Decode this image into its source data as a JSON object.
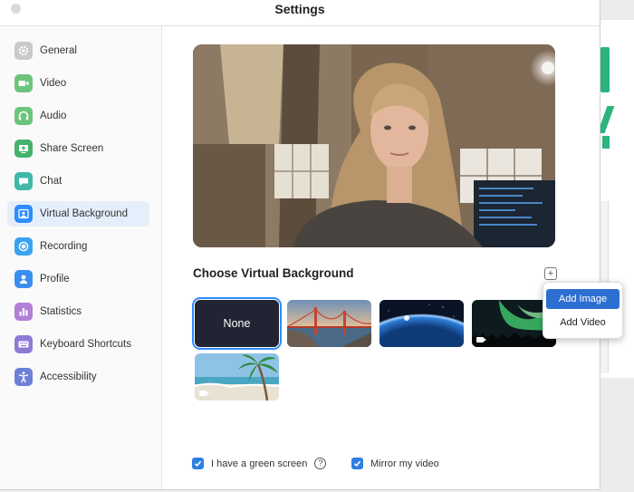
{
  "window": {
    "title": "Settings"
  },
  "colors": {
    "accent": "#2d8cff",
    "selection": "#e4effb",
    "menu_highlight": "#2d6fd1"
  },
  "sidebar": {
    "active": "Virtual Background",
    "items": [
      {
        "label": "General",
        "icon": "gear-icon",
        "color": "#c9c9c9"
      },
      {
        "label": "Video",
        "icon": "video-camera-icon",
        "color": "#6cc47c"
      },
      {
        "label": "Audio",
        "icon": "headphones-icon",
        "color": "#6cc47c"
      },
      {
        "label": "Share Screen",
        "icon": "share-screen-icon",
        "color": "#45b36b"
      },
      {
        "label": "Chat",
        "icon": "chat-bubble-icon",
        "color": "#40b8a8"
      },
      {
        "label": "Virtual Background",
        "icon": "virtual-background-icon",
        "color": "#2d8cff"
      },
      {
        "label": "Recording",
        "icon": "record-icon",
        "color": "#3aa3f0"
      },
      {
        "label": "Profile",
        "icon": "profile-icon",
        "color": "#3a8ef0"
      },
      {
        "label": "Statistics",
        "icon": "statistics-icon",
        "color": "#b27fd8"
      },
      {
        "label": "Keyboard Shortcuts",
        "icon": "keyboard-icon",
        "color": "#8e7bd6"
      },
      {
        "label": "Accessibility",
        "icon": "accessibility-icon",
        "color": "#6e7fd8"
      }
    ]
  },
  "main": {
    "heading": "Choose Virtual Background",
    "add_button_symbol": "+",
    "backgrounds": [
      {
        "label": "None",
        "selected": true
      },
      {
        "label": "",
        "icon": "golden-gate-bridge-image"
      },
      {
        "label": "",
        "icon": "earth-from-space-image"
      },
      {
        "label": "",
        "icon": "aurora-video",
        "is_video": true
      },
      {
        "label": "",
        "icon": "beach-palm-video",
        "is_video": true
      }
    ],
    "green_screen": {
      "label": "I have a green screen",
      "checked": true,
      "help": "?"
    },
    "mirror": {
      "label": "Mirror my video",
      "checked": true
    }
  },
  "menu": {
    "items": [
      {
        "label": "Add Image",
        "highlighted": true
      },
      {
        "label": "Add Video",
        "highlighted": false
      }
    ]
  }
}
